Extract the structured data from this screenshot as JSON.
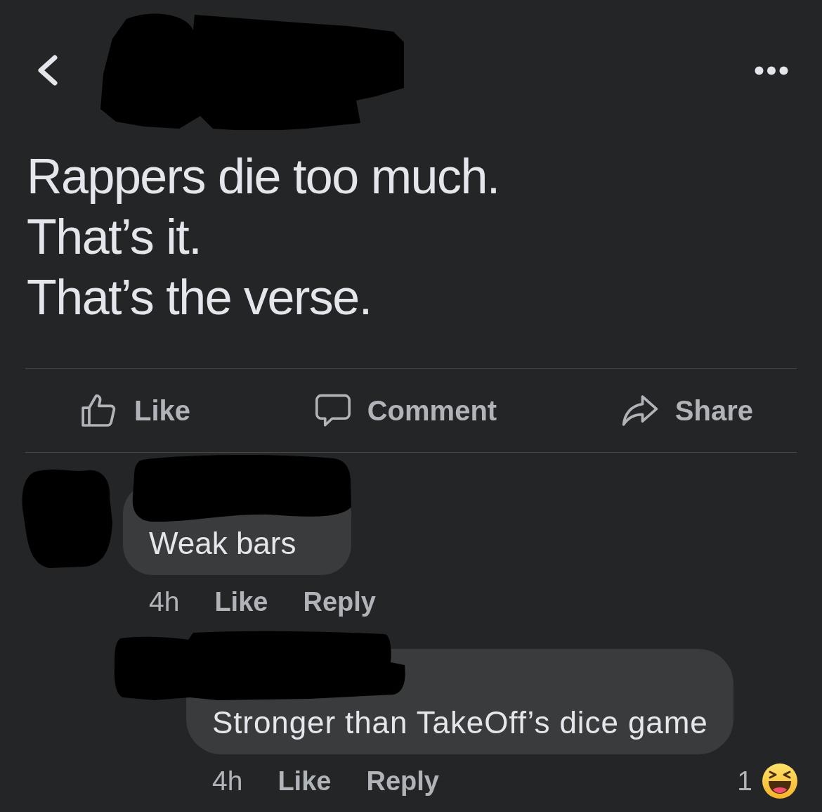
{
  "post": {
    "author_redacted": true,
    "lines": [
      "Rappers die too much.",
      "That’s it.",
      "That’s the verse."
    ]
  },
  "actions": [
    {
      "kind": "like",
      "label": "Like"
    },
    {
      "kind": "comment",
      "label": "Comment"
    },
    {
      "kind": "share",
      "label": "Share"
    }
  ],
  "comments": [
    {
      "author_redacted": true,
      "text": "Weak bars",
      "time": "4h",
      "like_label": "Like",
      "reply_label": "Reply",
      "replies": [
        {
          "author_redacted": true,
          "text": "Stronger than TakeOff’s dice game",
          "time": "4h",
          "like_label": "Like",
          "reply_label": "Reply",
          "reactions": {
            "count": "1",
            "kind": "haha"
          }
        }
      ]
    }
  ]
}
